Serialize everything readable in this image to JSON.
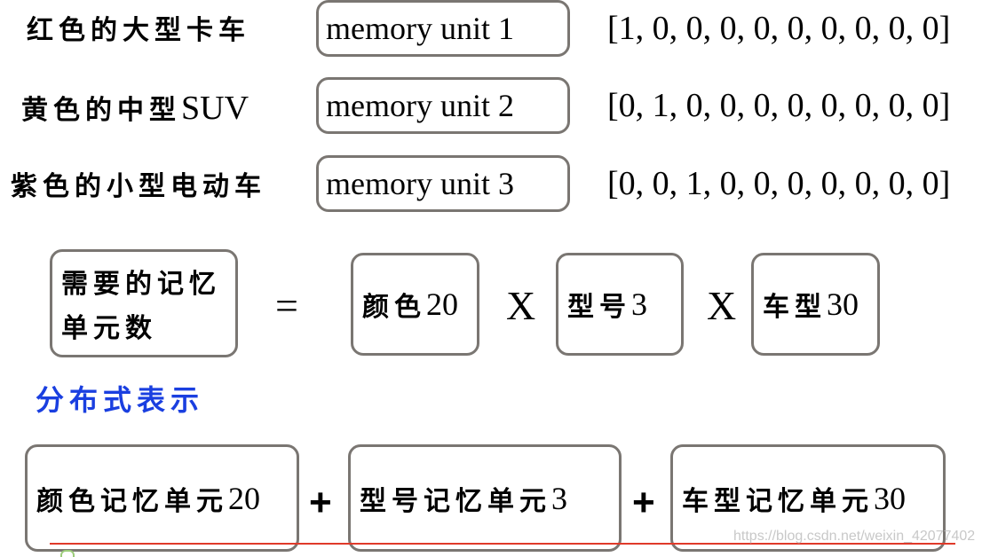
{
  "one_hot": {
    "rows": [
      {
        "description": "红色的大型卡车",
        "memory_unit": "memory unit 1",
        "vector": "[1, 0, 0, 0, 0, 0, 0, 0, 0, 0]"
      },
      {
        "description_cn": "黄色的中型",
        "description_en": "SUV",
        "memory_unit": "memory unit 2",
        "vector": "[0, 1, 0, 0, 0, 0, 0, 0, 0, 0]"
      },
      {
        "description": "紫色的小型电动车",
        "memory_unit": "memory unit 3",
        "vector": "[0, 0, 1, 0, 0, 0, 0, 0, 0, 0]"
      }
    ]
  },
  "equation": {
    "lhs_line1": "需要的记忆",
    "lhs_line2": "单元数",
    "equals": "=",
    "factors": [
      {
        "text": "颜色",
        "num": "20"
      },
      {
        "text": "型号",
        "num": "3"
      },
      {
        "text": "车型",
        "num": "30"
      }
    ],
    "times": "X"
  },
  "distributed": {
    "title": "分布式表示",
    "title_color": "#1a3fe0",
    "terms": [
      {
        "text": "颜色记忆单元",
        "num": "20"
      },
      {
        "text": "型号记忆单元",
        "num": "3"
      },
      {
        "text": "车型记忆单元",
        "num": "30"
      }
    ],
    "plus": "+"
  },
  "watermark": "https://blog.csdn.net/weixin_42077402"
}
